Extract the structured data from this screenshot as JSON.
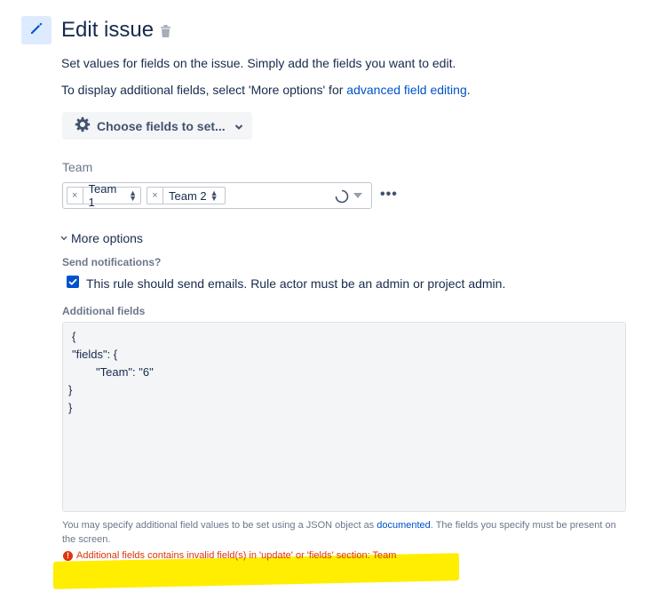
{
  "header": {
    "title": "Edit issue",
    "edit_icon": "pencil-icon",
    "delete_icon": "trash-icon"
  },
  "description": {
    "line1": "Set values for fields on the issue. Simply add the fields you want to edit.",
    "line2_prefix": "To display additional fields, select 'More options' for ",
    "line2_link": "advanced field editing",
    "line2_suffix": "."
  },
  "choose_fields": {
    "label": "Choose fields to set...",
    "icon": "gear-icon"
  },
  "team_field": {
    "label": "Team",
    "selected": [
      {
        "label": "Team 1"
      },
      {
        "label": "Team 2"
      }
    ],
    "more_icon": "more-horizontal-icon"
  },
  "more_options": {
    "label": "More options",
    "expanded": true
  },
  "notifications": {
    "label": "Send notifications?",
    "checkbox_label": "This rule should send emails. Rule actor must be an admin or project admin.",
    "checked": true
  },
  "additional_fields": {
    "label": "Additional fields",
    "json_lines": [
      "{",
      "\"fields\": {",
      "\"Team\": \"6\"",
      "}",
      "}"
    ],
    "help_prefix": "You may specify additional field values to be set using a JSON object as ",
    "help_link": "documented",
    "help_suffix": ". The fields you specify must be present on the screen.",
    "error": "Additional fields contains invalid field(s) in 'update' or 'fields' section: Team"
  },
  "colors": {
    "primary": "#0052cc",
    "error": "#de350b",
    "highlight": "#ffee00"
  }
}
